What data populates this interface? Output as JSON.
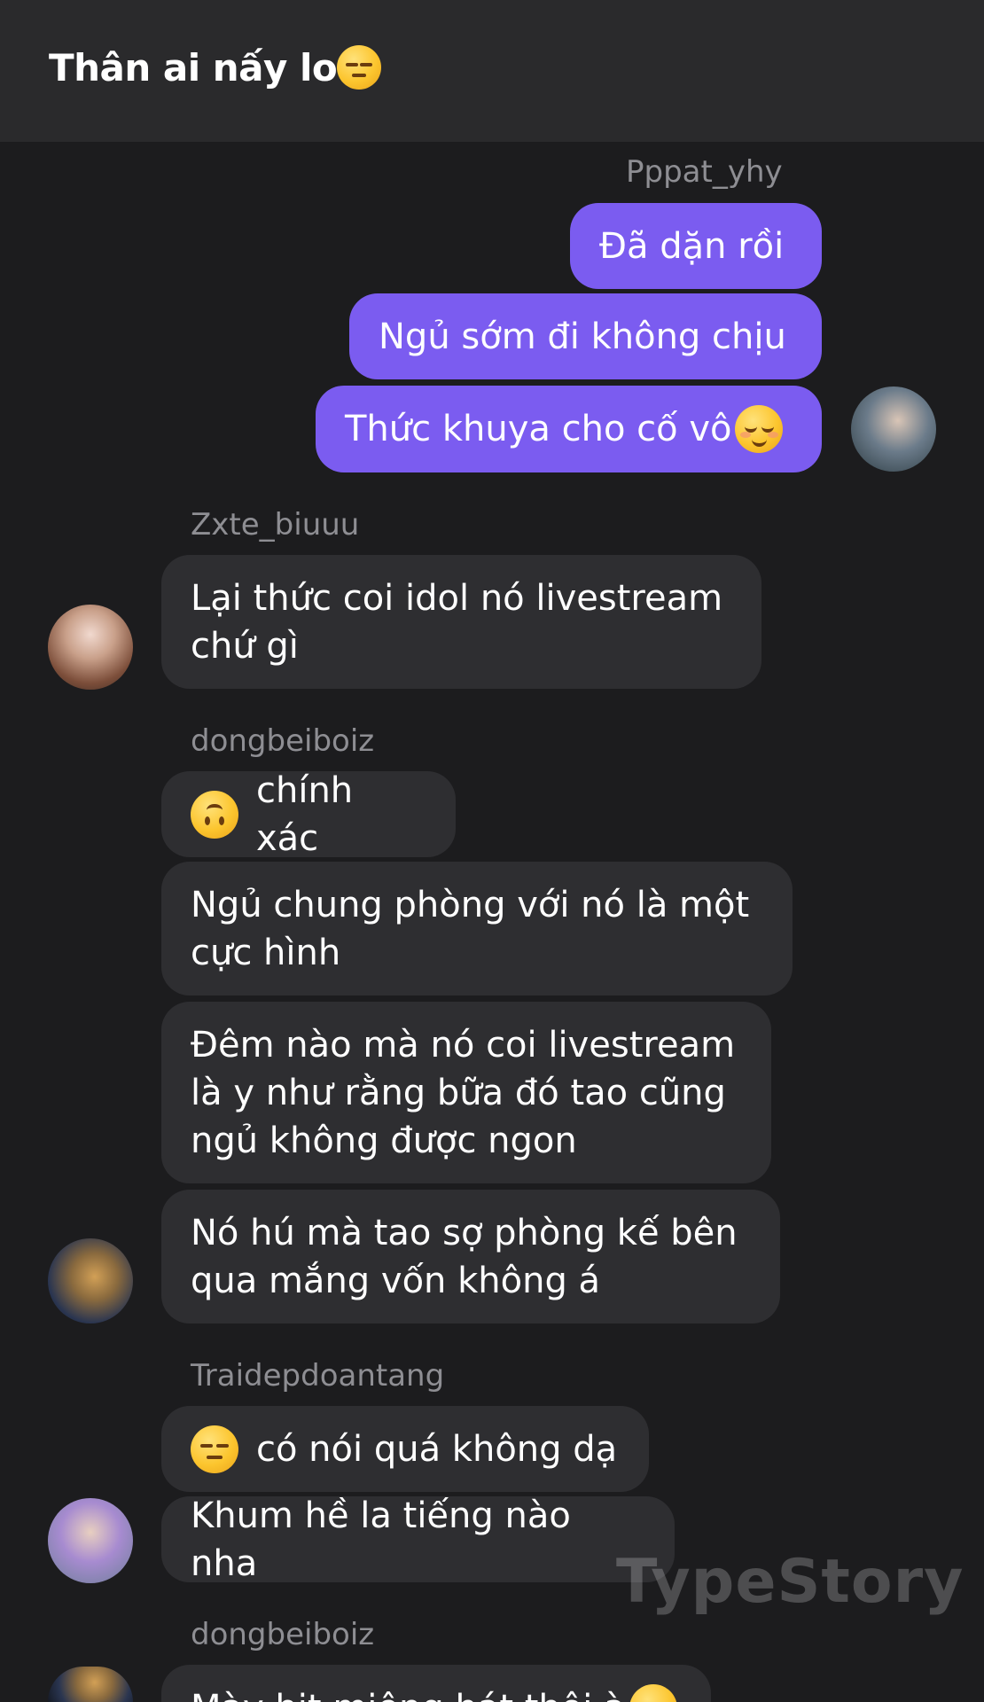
{
  "header": {
    "title": "Thân ai nấy lo",
    "title_emoji": "unamused-face-icon"
  },
  "messages": {
    "group1": {
      "sender": "Pppat_yhy",
      "b1": "Đã dặn rồi",
      "b2": "Ngủ sớm đi không chịu",
      "b3": "Thức khuya cho cố vô",
      "b3_emoji": "relieved-face-icon"
    },
    "group2": {
      "sender": "Zxte_biuuu",
      "b1": "Lại thức coi idol nó livestream\nchứ gì"
    },
    "group3": {
      "sender": "dongbeiboiz",
      "b1": "chính xác",
      "b1_emoji": "upside-down-face-icon",
      "b2": "Ngủ chung phòng với nó là một\ncực hình",
      "b3": "Đêm nào mà nó coi livestream\nlà y như rằng bữa đó tao cũng\nngủ không được ngon",
      "b4": "Nó hú mà tao sợ phòng kế bên\nqua mắng vốn không á"
    },
    "group4": {
      "sender": "Traidepdoantang",
      "b1": "có nói quá không dạ",
      "b1_emoji": "unamused-face-icon",
      "b2": "Khum hề la tiếng nào nha"
    },
    "group5": {
      "sender": "dongbeiboiz",
      "b1": "Mày bịt miệng hát thôi à",
      "b1_emoji": "unamused-face-icon"
    }
  },
  "watermark": "TypeStory",
  "colors": {
    "outgoing": "#7b5cf0",
    "incoming": "#2e2e31",
    "background": "#1c1c1e",
    "header": "#2a2a2c"
  }
}
